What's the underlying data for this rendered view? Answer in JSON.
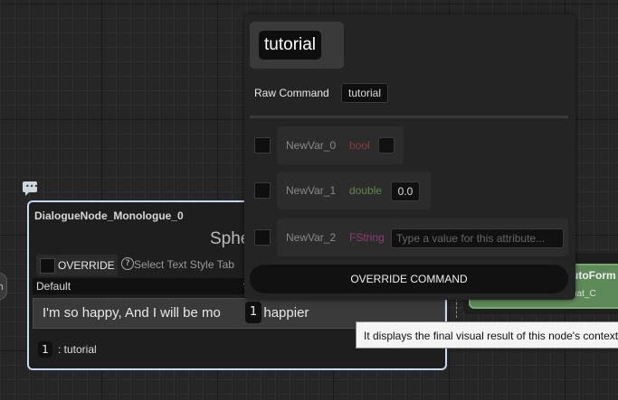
{
  "left_pin": {
    "label": "n"
  },
  "dialogue_node": {
    "title": "DialogueNode_Monologue_0",
    "sphere_label": "Sphe",
    "override_label": "OVERRIDE",
    "help_glyph": "?",
    "text_style_placeholder": "Select Text Style Tab",
    "style_dropdown_value": "Default",
    "dialogue_text": "I'm so happy, And I will be mo",
    "dialogue_text_rest": "re happier",
    "command_index": "1",
    "command_text": ": tutorial"
  },
  "green_node": {
    "title": "utoForm",
    "subtitle": "nat_C",
    "color": "#5e8a5a"
  },
  "popup": {
    "command_title": "tutorial",
    "raw_command_label": "Raw Command",
    "raw_command_value": "tutorial",
    "variables": [
      {
        "name": "NewVar_0",
        "type": "bool",
        "type_color": "#8a3b3b",
        "value": ""
      },
      {
        "name": "NewVar_1",
        "type": "double",
        "type_color": "#5a8a4a",
        "value": "0.0"
      },
      {
        "name": "NewVar_2",
        "type": "FString",
        "type_color": "#8a3d6a",
        "placeholder": "Type a value for this attribute..."
      }
    ],
    "override_button": "OVERRIDE COMMAND"
  },
  "pin_badge": "1",
  "tooltip": "It displays the final visual result of this node's context"
}
